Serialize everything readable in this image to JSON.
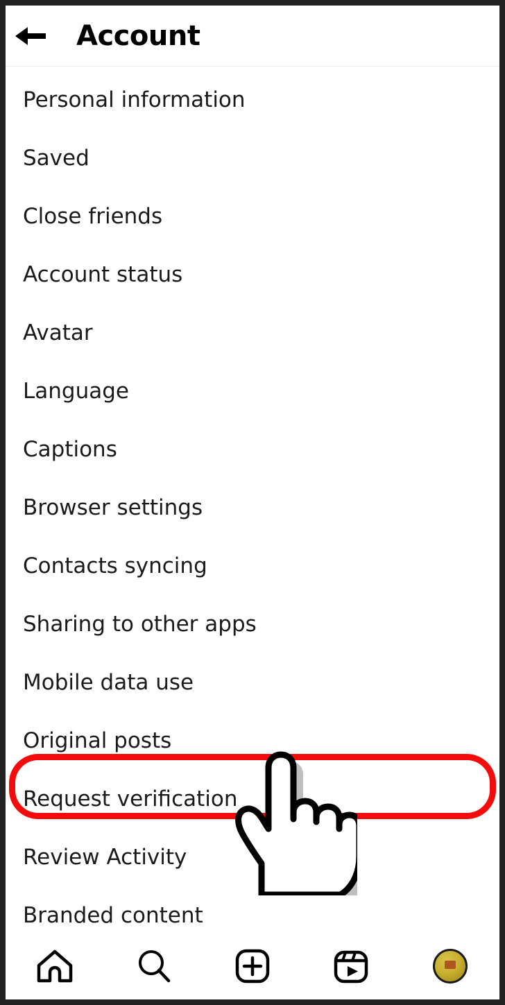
{
  "header": {
    "title": "Account",
    "back_icon": "arrow-left-icon"
  },
  "settings_list": {
    "items": [
      {
        "label": "Personal information",
        "highlighted": false
      },
      {
        "label": "Saved",
        "highlighted": false
      },
      {
        "label": "Close friends",
        "highlighted": false
      },
      {
        "label": "Account status",
        "highlighted": false
      },
      {
        "label": "Avatar",
        "highlighted": false
      },
      {
        "label": "Language",
        "highlighted": false
      },
      {
        "label": "Captions",
        "highlighted": false
      },
      {
        "label": "Browser settings",
        "highlighted": false
      },
      {
        "label": "Contacts syncing",
        "highlighted": false
      },
      {
        "label": "Sharing to other apps",
        "highlighted": false
      },
      {
        "label": "Mobile data use",
        "highlighted": false
      },
      {
        "label": "Original posts",
        "highlighted": false
      },
      {
        "label": "Request verification",
        "highlighted": true
      },
      {
        "label": "Review Activity",
        "highlighted": false
      },
      {
        "label": "Branded content",
        "highlighted": false
      }
    ]
  },
  "annotation": {
    "highlight_color": "#f40c0c",
    "highlight_target": "Request verification",
    "cursor_icon": "pointing-hand-cursor"
  },
  "bottom_nav": {
    "items": [
      {
        "icon": "home-icon",
        "name": "home"
      },
      {
        "icon": "search-icon",
        "name": "search"
      },
      {
        "icon": "create-plus-icon",
        "name": "create"
      },
      {
        "icon": "reels-icon",
        "name": "reels"
      },
      {
        "icon": "profile-avatar",
        "name": "profile"
      }
    ]
  },
  "colors": {
    "frame": "#222222",
    "background": "#ffffff",
    "text": "#1a1a1a",
    "accent": "#f40c0c",
    "avatar": "#c9b02f"
  }
}
